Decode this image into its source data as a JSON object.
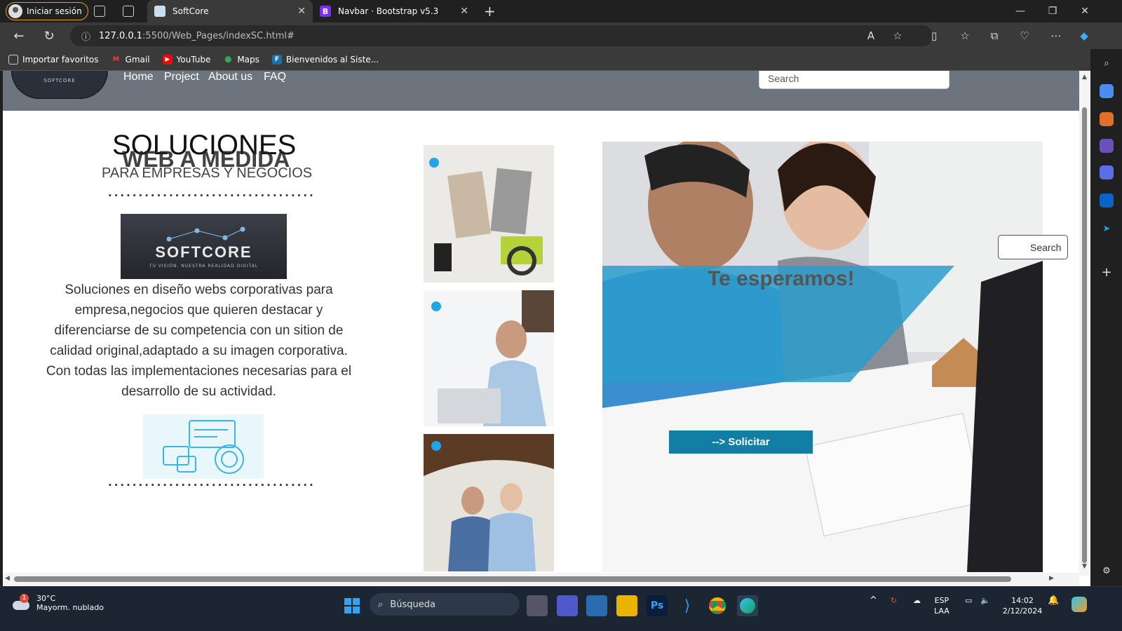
{
  "browser": {
    "profile_label": "Iniciar sesión",
    "tabs": [
      {
        "title": "SoftCore",
        "active": true
      },
      {
        "title": "Navbar · Bootstrap v5.3",
        "active": false,
        "favicon": "B"
      }
    ],
    "url_host": "127.0.0.1",
    "url_path": ":5500/Web_Pages/indexSC.html#",
    "bookmarks": [
      {
        "label": "Importar favoritos",
        "icon": "import-icon"
      },
      {
        "label": "Gmail",
        "icon": "gmail-icon"
      },
      {
        "label": "YouTube",
        "icon": "youtube-icon"
      },
      {
        "label": "Maps",
        "icon": "maps-icon"
      },
      {
        "label": "Bienvenidos al Siste...",
        "icon": "site-icon"
      }
    ]
  },
  "site": {
    "nav": {
      "home": "Home",
      "project": "Project",
      "about": "About us",
      "faq": "FAQ"
    },
    "search_placeholder": "Search",
    "side_search_placeholder": "Search",
    "heading_line1": "SOLUCIONES",
    "heading_line2": "WEB A MEDIDA",
    "subheading": "PARA EMPRESAS Y NEGOCIOS",
    "dots": "..................................",
    "logo_text": "SOFTCORE",
    "logo_subtext": "TU VISIÓN, NUESTRA REALIDAD DIGITAL",
    "body_text": "Soluciones en diseño webs corporativas para empresa,negocios que quieren destacar y diferenciarse de su competencia con un sition de calidad original,adaptado a su imagen corporativa. Con todas las implementaciones necesarias para el desarrollo de su actividad.",
    "banner_text": "Te esperamos!",
    "cta_label": "--> Solicitar"
  },
  "taskbar": {
    "weather_temp": "30°C",
    "weather_desc": "Mayorm. nublado",
    "weather_badge": "1",
    "search_label": "Búsqueda",
    "lang_line1": "ESP",
    "lang_line2": "LAA",
    "time": "14:02",
    "date": "2/12/2024"
  },
  "colors": {
    "site_nav": "#6c757d",
    "cta": "#117ea3",
    "banner": "#2a9ccc"
  }
}
